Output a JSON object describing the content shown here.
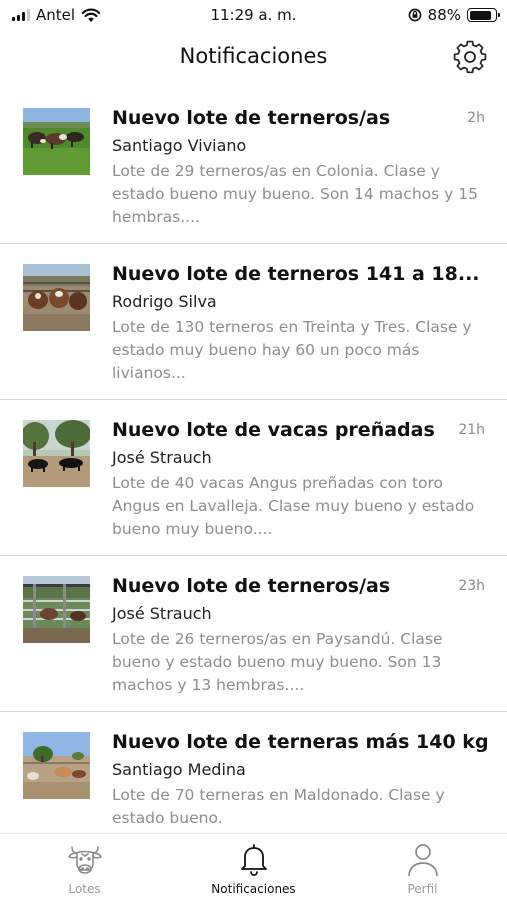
{
  "status_bar": {
    "carrier": "Antel",
    "time": "11:29 a. m.",
    "battery": "88%",
    "battery_level": 0.88
  },
  "header": {
    "title": "Notificaciones",
    "settings_icon": "gear-icon"
  },
  "notifications": [
    {
      "title": "Nuevo lote de terneros/as",
      "time": "2h",
      "author": "Santiago Viviano",
      "description": "Lote de 29 terneros/as en Colonia. Clase y estado bueno muy bueno. Son 14 machos y 15 hembras....",
      "thumbnail": "calves-in-green-field"
    },
    {
      "title": "Nuevo lote de terneros 141 a 18...",
      "time": "",
      "author": "Rodrigo Silva",
      "description": "Lote de 130 terneros en Treinta y Tres. Clase y estado muy bueno hay 60 un poco más livianos...",
      "thumbnail": "calves-in-pen"
    },
    {
      "title": "Nuevo lote de vacas preñadas",
      "time": "21h",
      "author": "José Strauch",
      "description": "Lote de 40 vacas Angus preñadas con toro Angus en Lavalleja. Clase muy bueno y estado bueno muy bueno....",
      "thumbnail": "angus-cows-under-trees"
    },
    {
      "title": "Nuevo lote de terneros/as",
      "time": "23h",
      "author": "José Strauch",
      "description": "Lote de 26 terneros/as en Paysandú. Clase bueno y estado bueno muy bueno. Son 13 machos y 13 hembras....",
      "thumbnail": "calves-behind-fence"
    },
    {
      "title": "Nuevo lote de terneras más 140 kg",
      "time": "",
      "author": "Santiago Medina",
      "description": "Lote de 70 terneras en Maldonado. Clase y estado bueno.",
      "thumbnail": "heifers-in-corral"
    }
  ],
  "tab_bar": {
    "tabs": [
      {
        "label": "Lotes",
        "icon": "cow-head-icon",
        "active": false
      },
      {
        "label": "Notificaciones",
        "icon": "bell-icon",
        "active": true
      },
      {
        "label": "Perfil",
        "icon": "person-icon",
        "active": false
      }
    ]
  }
}
